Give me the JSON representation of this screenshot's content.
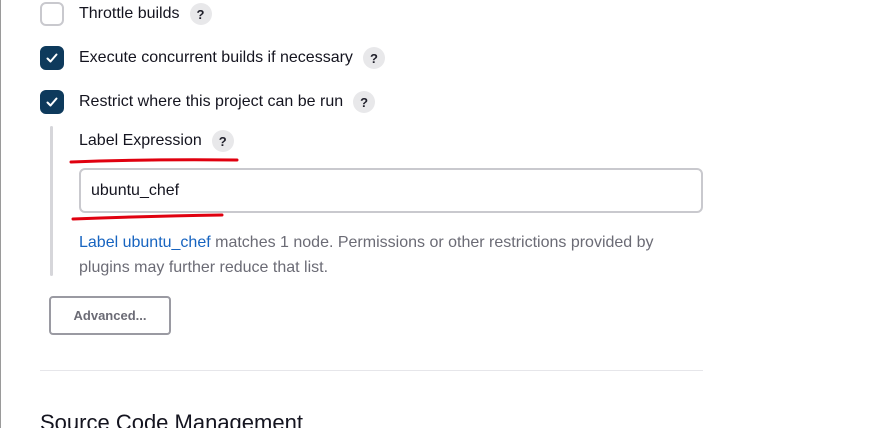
{
  "options": [
    {
      "label": "Throttle builds",
      "checked": false
    },
    {
      "label": "Execute concurrent builds if necessary",
      "checked": true
    },
    {
      "label": "Restrict where this project can be run",
      "checked": true
    }
  ],
  "help_glyph": "?",
  "label_expression": {
    "title": "Label Expression",
    "value": "ubuntu_chef"
  },
  "hint": {
    "prefix": "Label ",
    "link_text": "ubuntu_chef",
    "rest": " matches 1 node. Permissions or other restrictions provided by plugins may further reduce that list."
  },
  "advanced_button": "Advanced...",
  "next_section": "Source Code Management",
  "colors": {
    "accent": "#0e3a5c",
    "link": "#1764c0",
    "annotation": "#e0000f"
  }
}
